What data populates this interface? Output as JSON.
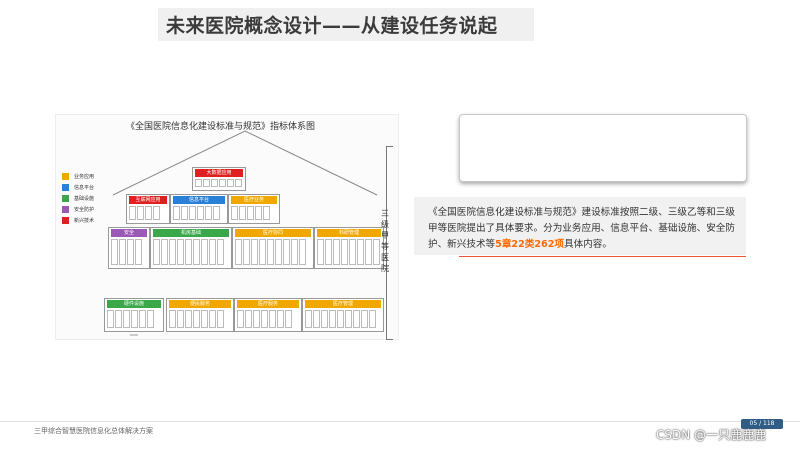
{
  "header": {
    "title": "未来医院概念设计——从建设任务说起"
  },
  "diagram": {
    "title": "《全国医院信息化建设标准与规范》指标体系图",
    "legend": [
      {
        "label": "业务应用",
        "color": "#f0a800"
      },
      {
        "label": "信息平台",
        "color": "#2a80d6"
      },
      {
        "label": "基础设施",
        "color": "#3aa84a"
      },
      {
        "label": "安全防护",
        "color": "#9b59b6"
      },
      {
        "label": "新兴技术",
        "color": "#e02020"
      }
    ],
    "side_label": "三级甲等医院",
    "blocks": [
      {
        "label": "大数据应用",
        "color": "#e02020"
      },
      {
        "label": "互联网应用",
        "color": "#e02020"
      },
      {
        "label": "信息平台",
        "color": "#2a80d6"
      },
      {
        "label": "医疗业务",
        "color": "#f0a800"
      },
      {
        "label": "安全",
        "color": "#9b59b6"
      },
      {
        "label": "机房基础",
        "color": "#3aa84a"
      },
      {
        "label": "医疗协同",
        "color": "#f0a800"
      },
      {
        "label": "科研管理",
        "color": "#f0a800"
      },
      {
        "label": "硬件设施",
        "color": "#3aa84a"
      },
      {
        "label": "便民服务",
        "color": "#f0a800"
      },
      {
        "label": "医疗服务",
        "color": "#f0a800"
      },
      {
        "label": "医疗管理",
        "color": "#f0a800"
      }
    ]
  },
  "description": {
    "text_before": "《全国医院信息化建设标准与规范》建设标准按照二级、三级乙等和三级甲等医院提出了具体要求。分为业务应用、信息平台、基础设施、安全防护、新兴技术等",
    "highlight": "5章22类262项",
    "text_after": "具体内容。"
  },
  "footer": {
    "text": "三甲综合智慧医院信息化总体解决方案",
    "page": "05 / 118",
    "watermark": "CSDN @一只鹿鹿鹿"
  }
}
